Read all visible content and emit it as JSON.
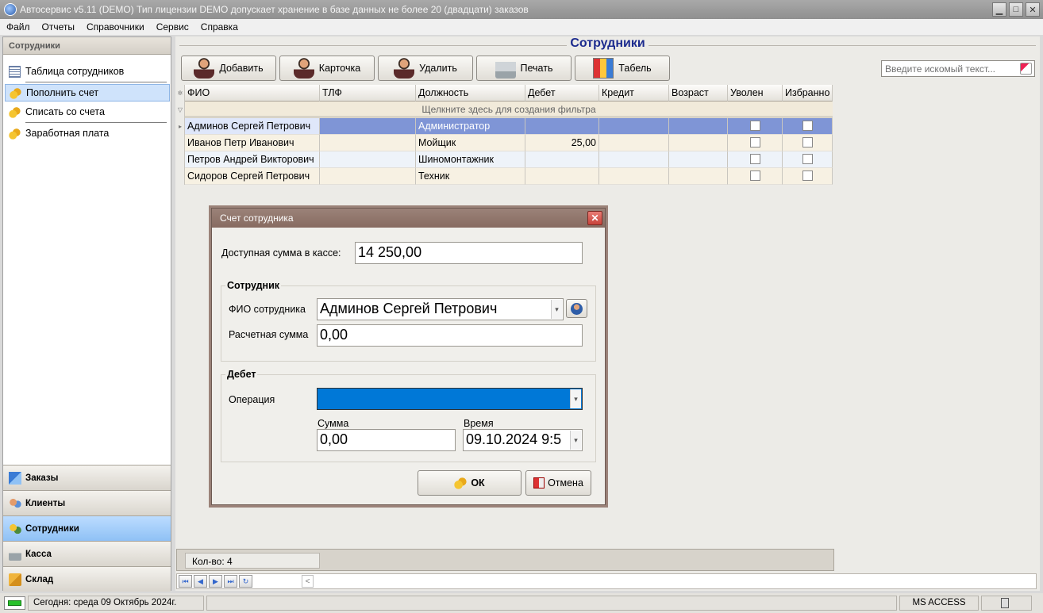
{
  "window": {
    "title": "Автосервис v5.11 (DEMO) Тип лицензии DEMO допускает хранение в базе данных не более 20 (двадцати) заказов",
    "controls": {
      "minimize": "▁",
      "maximize": "□",
      "close": "✕"
    }
  },
  "menu": {
    "items": [
      "Файл",
      "Отчеты",
      "Справочники",
      "Сервис",
      "Справка"
    ]
  },
  "sidebar": {
    "header": "Сотрудники",
    "links": [
      {
        "label": "Таблица сотрудников",
        "icon": "table-icon"
      },
      {
        "label": "Пополнить счет",
        "icon": "coins-icon",
        "active": true
      },
      {
        "label": "Списать со счета",
        "icon": "coins-icon"
      },
      {
        "label": "Заработная плата",
        "icon": "coins-icon"
      }
    ],
    "nav": [
      {
        "label": "Заказы",
        "icon": "orders-icon"
      },
      {
        "label": "Клиенты",
        "icon": "clients-icon"
      },
      {
        "label": "Сотрудники",
        "icon": "employees-icon",
        "active": true
      },
      {
        "label": "Касса",
        "icon": "cash-icon"
      },
      {
        "label": "Склад",
        "icon": "warehouse-icon"
      }
    ]
  },
  "main": {
    "title": "Сотрудники",
    "toolbar": {
      "add": "Добавить",
      "card": "Карточка",
      "delete": "Удалить",
      "print": "Печать",
      "timesheet": "Табель"
    },
    "search": {
      "placeholder": "Введите искомый текст..."
    },
    "grid": {
      "columns": [
        "ФИО",
        "ТЛФ",
        "Должность",
        "Дебет",
        "Кредит",
        "Возраст",
        "Уволен",
        "Избранно"
      ],
      "filter_hint": "Щелкните здесь для создания фильтра",
      "rows": [
        {
          "name": "Админов Сергей Петрович",
          "phone": "",
          "position": "Администратор",
          "debit": "",
          "credit": "",
          "age": "",
          "fired": false,
          "favorite": false
        },
        {
          "name": "Иванов Петр Иванович",
          "phone": "",
          "position": "Мойщик",
          "debit": "25,00",
          "credit": "",
          "age": "",
          "fired": false,
          "favorite": false
        },
        {
          "name": "Петров Андрей Викторович",
          "phone": "",
          "position": "Шиномонтажник",
          "debit": "",
          "credit": "",
          "age": "",
          "fired": false,
          "favorite": false
        },
        {
          "name": "Сидоров Сергей Петрович",
          "phone": "",
          "position": "Техник",
          "debit": "",
          "credit": "",
          "age": "",
          "fired": false,
          "favorite": false
        }
      ]
    },
    "count_label": "Кол-во: 4",
    "navigator": [
      "⏮",
      "◀",
      "▶",
      "⏭",
      "↻"
    ]
  },
  "status": {
    "today": "Сегодня: среда 09 Октябрь 2024г.",
    "db": "MS ACCESS"
  },
  "dialog": {
    "title": "Счет сотрудника",
    "available_label": "Доступная сумма в кассе:",
    "available_value": "14 250,00",
    "employee_group": "Сотрудник",
    "employee_label": "ФИО сотрудника",
    "employee_value": "Админов Сергей Петрович",
    "calc_label": "Расчетная сумма",
    "calc_value": "0,00",
    "debit_group": "Дебет",
    "operation_label": "Операция",
    "operation_value": "",
    "sum_label": "Сумма",
    "sum_value": "0,00",
    "time_label": "Время",
    "time_value": "09.10.2024 9:5",
    "ok": "ОК",
    "cancel": "Отмена"
  }
}
